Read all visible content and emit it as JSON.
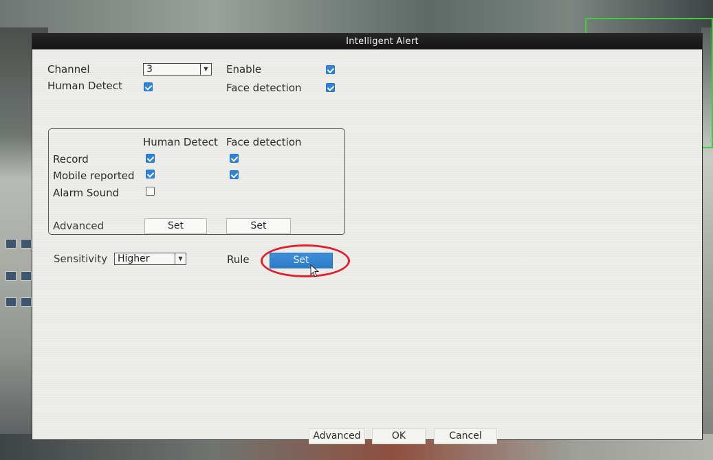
{
  "window": {
    "title": "Intelligent Alert"
  },
  "settings": {
    "channel_label": "Channel",
    "channel_value": "3",
    "enable_label": "Enable",
    "enable_checked": true,
    "human_detect_label": "Human Detect",
    "human_detect_checked": true,
    "face_detection_label": "Face detection",
    "face_detection_checked": true
  },
  "actions_group": {
    "columns": [
      "Human Detect",
      "Face detection"
    ],
    "rows": [
      {
        "label": "Record",
        "human_detect": true,
        "face_detection": true
      },
      {
        "label": "Mobile reported",
        "human_detect": true,
        "face_detection": true
      },
      {
        "label": "Alarm Sound",
        "human_detect": false,
        "face_detection": null
      }
    ],
    "advanced_label": "Advanced",
    "set_human_label": "Set",
    "set_face_label": "Set"
  },
  "sensitivity": {
    "label": "Sensitivity",
    "value": "Higher"
  },
  "rule": {
    "label": "Rule",
    "set_label": "Set"
  },
  "footer": {
    "advanced_label": "Advanced",
    "ok_label": "OK",
    "cancel_label": "Cancel"
  },
  "colors": {
    "accent": "#2f84d8",
    "titlebar": "#1b1b1b",
    "highlight": "#e0202a",
    "detection_box": "#3fcf3a"
  },
  "icons": [
    "chevron-down-icon",
    "checkbox-checked-icon",
    "checkbox-empty-icon",
    "mouse-pointer-icon"
  ]
}
